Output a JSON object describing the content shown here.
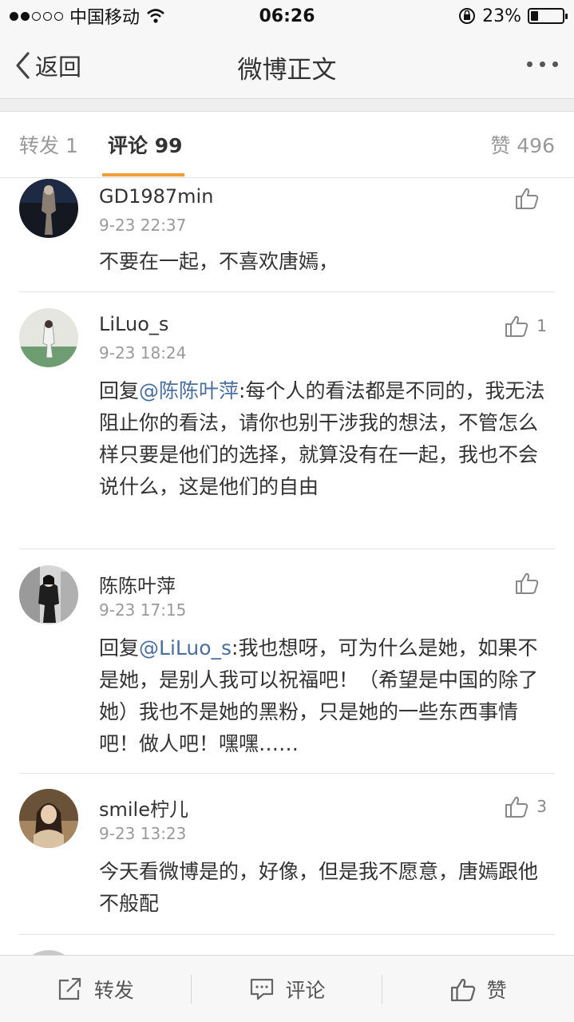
{
  "status_bar": {
    "carrier": "中国移动",
    "time": "06:26",
    "battery_percent": "23%",
    "battery_level": 0.23
  },
  "nav": {
    "back_label": "返回",
    "title": "微博正文"
  },
  "tabs": {
    "repost": "转发 1",
    "comment": "评论 99",
    "like": "赞 496"
  },
  "comments": [
    {
      "name": "GD1987min",
      "time": "9-23 22:37",
      "text": "不要在一起，不喜欢唐嫣，",
      "likes": ""
    },
    {
      "name": "LiLuo_s",
      "time": "9-23 18:24",
      "reply_prefix": "回复",
      "mention": "@陈陈叶萍",
      "text": ":每个人的看法都是不同的，我无法阻止你的看法，请你也别干涉我的想法，不管怎么样只要是他们的选择，就算没有在一起，我也不会说什么，这是他们的自由",
      "likes": "1"
    },
    {
      "name": "陈陈叶萍",
      "time": "9-23 17:15",
      "reply_prefix": "回复",
      "mention": "@LiLuo_s",
      "text": ":我也想呀，可为什么是她，如果不是她，是别人我可以祝福吧！（希望是中国的除了她）我也不是她的黑粉，只是她的一些东西事情吧！做人吧！嘿嘿……",
      "likes": ""
    },
    {
      "name": "smile柠儿",
      "time": "9-23 13:23",
      "text": "今天看微博是的，好像，但是我不愿意，唐嫣跟他不般配",
      "likes": "3"
    }
  ],
  "toolbar": {
    "repost": "转发",
    "comment": "评论",
    "like": "赞"
  }
}
